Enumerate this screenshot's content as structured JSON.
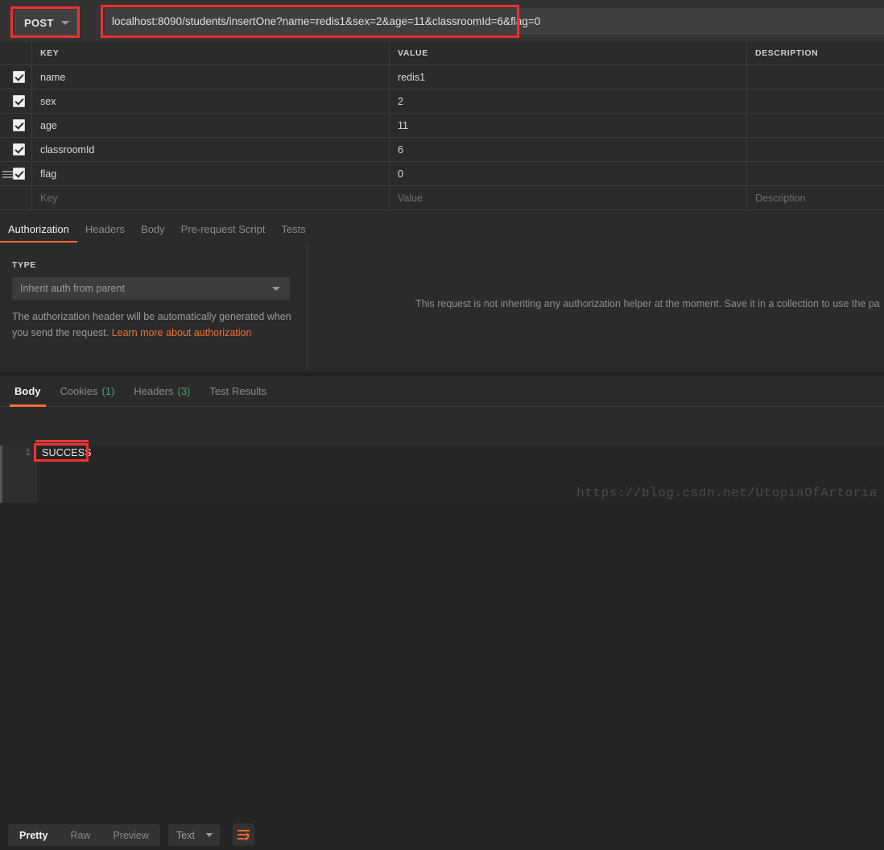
{
  "request": {
    "method": "POST",
    "url": "localhost:8090/students/insertOne?name=redis1&sex=2&age=11&classroomId=6&flag=0",
    "method_caret": "chevron-down-icon"
  },
  "params_table": {
    "headers": {
      "key": "KEY",
      "value": "VALUE",
      "description": "DESCRIPTION"
    },
    "rows": [
      {
        "checked": true,
        "key": "name",
        "value": "redis1",
        "description": ""
      },
      {
        "checked": true,
        "key": "sex",
        "value": "2",
        "description": ""
      },
      {
        "checked": true,
        "key": "age",
        "value": "11",
        "description": ""
      },
      {
        "checked": true,
        "key": "classroomId",
        "value": "6",
        "description": ""
      },
      {
        "checked": true,
        "key": "flag",
        "value": "0",
        "description": ""
      }
    ],
    "new_row": {
      "key_placeholder": "Key",
      "value_placeholder": "Value",
      "description_placeholder": "Description"
    }
  },
  "request_tabs": [
    {
      "label": "Authorization",
      "active": true
    },
    {
      "label": "Headers",
      "active": false
    },
    {
      "label": "Body",
      "active": false
    },
    {
      "label": "Pre-request Script",
      "active": false
    },
    {
      "label": "Tests",
      "active": false
    }
  ],
  "authorization": {
    "type_label": "TYPE",
    "type_value": "Inherit auth from parent",
    "note_text": "The authorization header will be automatically generated when you send the request. ",
    "note_link": "Learn more about authorization",
    "info_message": "This request is not inheriting any authorization helper at the moment. Save it in a collection to use the pa"
  },
  "response_tabs": [
    {
      "label": "Body",
      "count": "",
      "active": true
    },
    {
      "label": "Cookies",
      "count": "(1)",
      "active": false
    },
    {
      "label": "Headers",
      "count": "(3)",
      "active": false
    },
    {
      "label": "Test Results",
      "count": "",
      "active": false
    }
  ],
  "body_toolbar": {
    "view_modes": [
      {
        "label": "Pretty",
        "active": true
      },
      {
        "label": "Raw",
        "active": false
      },
      {
        "label": "Preview",
        "active": false
      }
    ],
    "format_value": "Text",
    "wrap_icon": "word-wrap-icon"
  },
  "response_body": {
    "line_number": "1",
    "content": "SUCCESS"
  },
  "watermark": "https://blog.csdn.net/UtopiaOfArtoria",
  "colors": {
    "accent": "#ff6c37",
    "annotation": "#f03030",
    "count_green": "#4aa56c",
    "link": "#e8703a"
  }
}
